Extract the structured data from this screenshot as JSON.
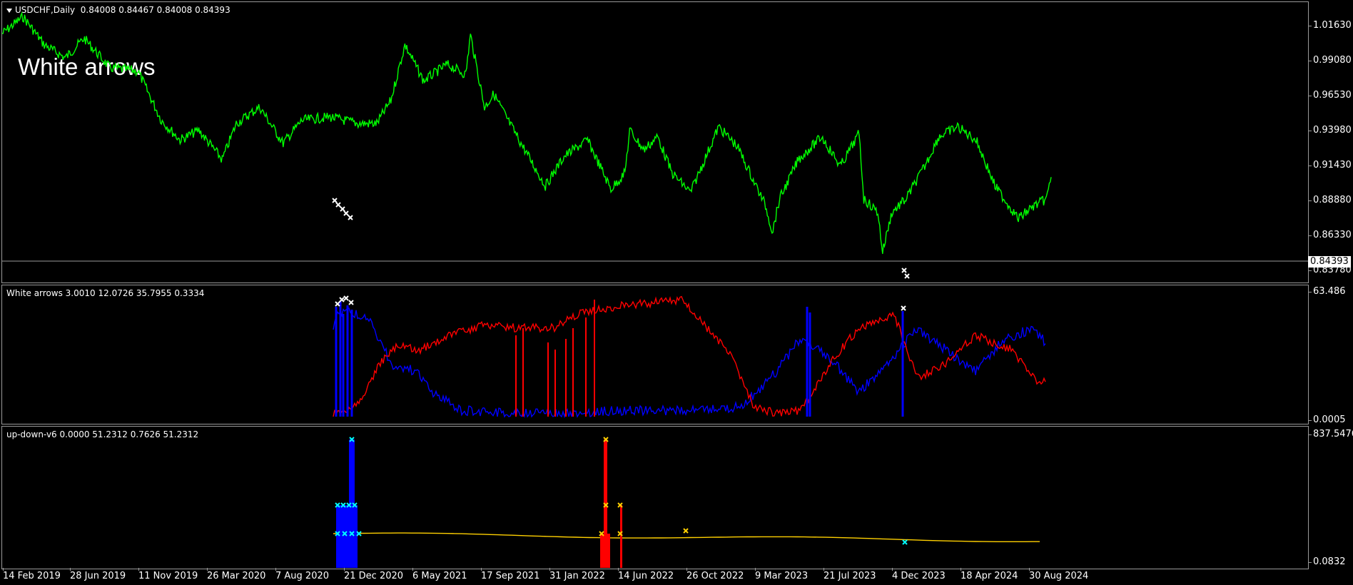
{
  "main": {
    "symbol_label": "USDCHF,Daily",
    "ohlc": "0.84008 0.84467 0.84008 0.84393",
    "overlay_label": "White arrows",
    "price_ticks": [
      "1.01630",
      "0.99080",
      "0.96530",
      "0.93980",
      "0.91430",
      "0.88880",
      "0.86330",
      "0.83780"
    ],
    "current_price": "0.84393",
    "colors": {
      "price": "#00ff00",
      "arrow": "#ffffff",
      "grid": "#9a9a9a"
    }
  },
  "ind1": {
    "label": "White arrows 3.0010 12.0726 35.7955 0.3334",
    "ticks": [
      "63.486",
      "0.0005"
    ],
    "colors": {
      "blue": "#0000ff",
      "red": "#ff0000"
    }
  },
  "ind2": {
    "label": "up-down-v6 0.0000 51.2312 0.7626 51.2312",
    "ticks": [
      "837.5476",
      "0.0832"
    ],
    "colors": {
      "blue": "#0000ff",
      "red": "#ff0000",
      "yellow": "#ffd000",
      "cyan": "#00ffff"
    }
  },
  "xaxis": {
    "dates": [
      "14 Feb 2019",
      "28 Jun 2019",
      "11 Nov 2019",
      "26 Mar 2020",
      "7 Aug 2020",
      "21 Dec 2020",
      "6 May 2021",
      "17 Sep 2021",
      "31 Jan 2022",
      "14 Jun 2022",
      "26 Oct 2022",
      "9 Mar 2023",
      "21 Jul 2023",
      "4 Dec 2023",
      "18 Apr 2024",
      "30 Aug 2024"
    ]
  }
}
